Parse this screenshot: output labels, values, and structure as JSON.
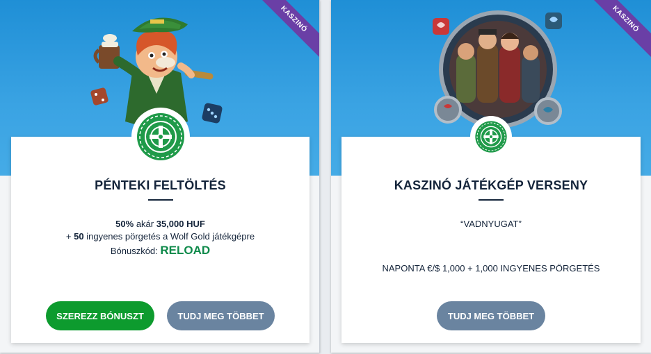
{
  "promos": [
    {
      "ribbon": "KASZINÓ",
      "title": "PÉNTEKI FELTÖLTÉS",
      "offer": {
        "pct": "50%",
        "text1": " akár ",
        "amount": "35,000 HUF",
        "plus": "+ ",
        "spins": "50",
        "text2": " ingyenes pörgetés a Wolf Gold játékgépre",
        "code_label": "Bónuszkód: ",
        "code": "RELOAD"
      },
      "primary_button": "SZEREZZ BÓNUSZT",
      "secondary_button": "TUDJ MEG TÖBBET"
    },
    {
      "ribbon": "KASZINÓ",
      "title": "KASZINÓ JÁTÉKGÉP VERSENY",
      "subtitle": "“VADNYUGAT”",
      "prize": "NAPONTA €/$ 1,000 + 1,000 INGYENES PÖRGETÉS",
      "secondary_button": "TUDJ MEG TÖBBET"
    }
  ],
  "icons": {
    "badge": "roulette-wheel-icon"
  },
  "colors": {
    "brand_green": "#0d9b2e",
    "banner_blue": "#2e9be0",
    "ribbon_purple": "#6a3fa6",
    "button_grey": "#6a84a0"
  }
}
